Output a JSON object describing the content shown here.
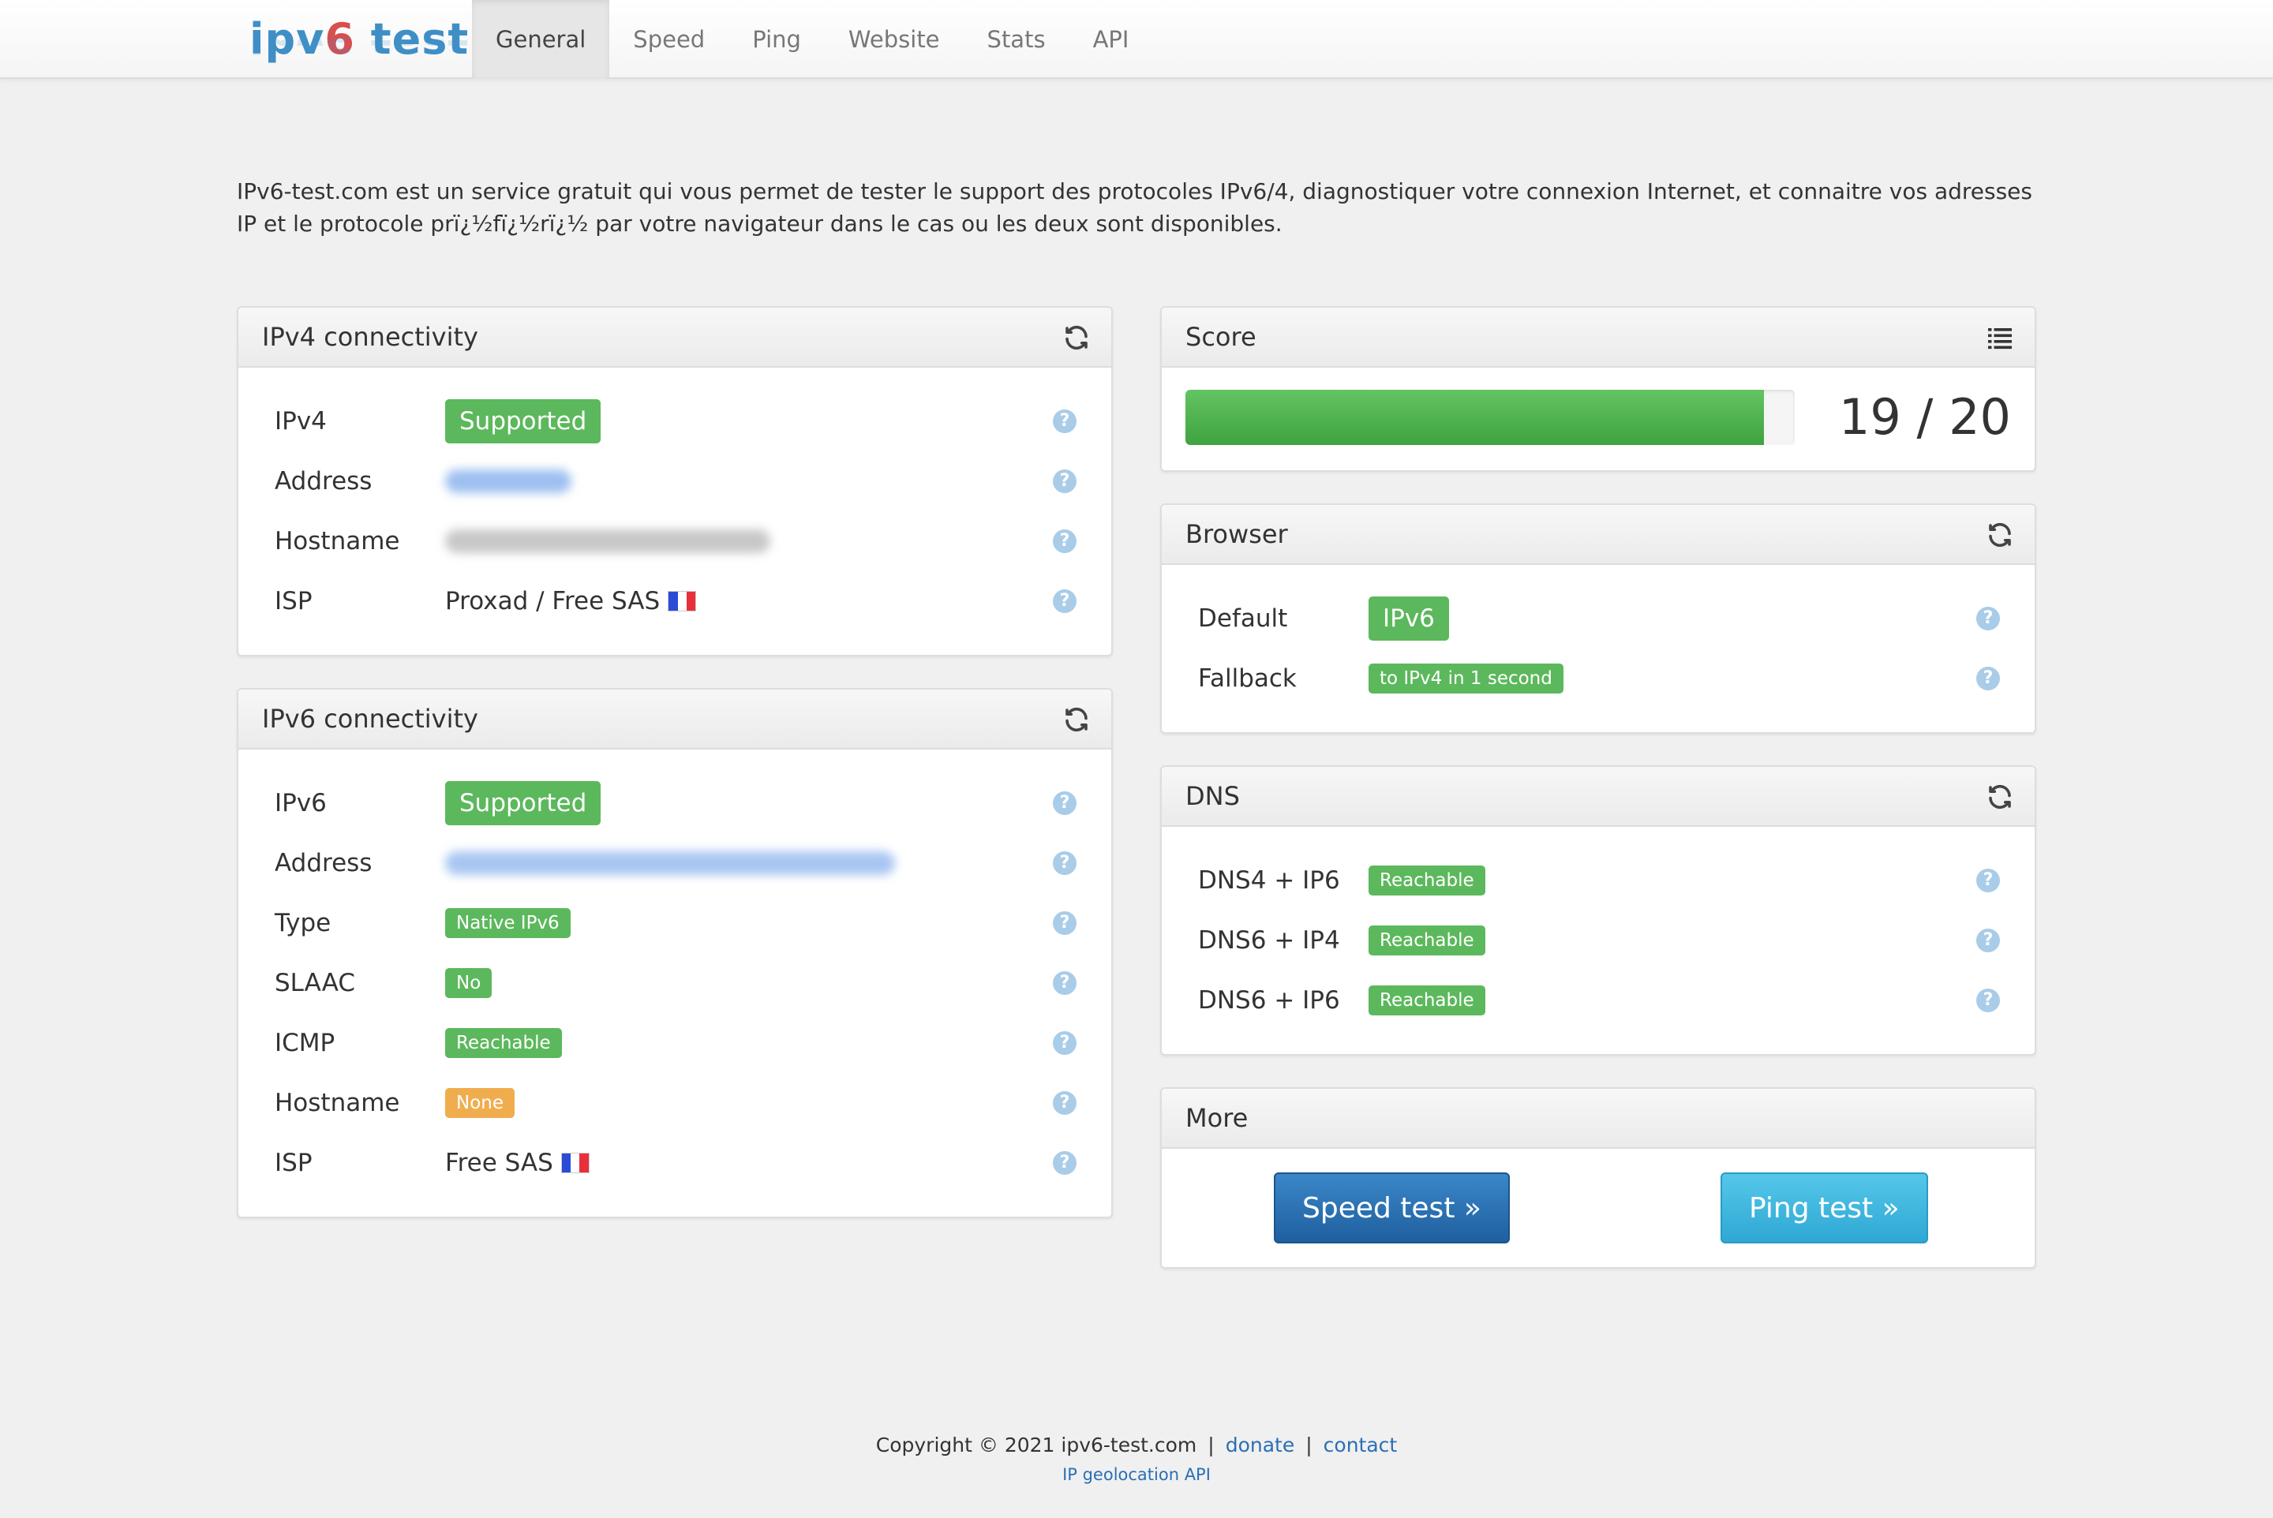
{
  "brand": {
    "part1": "ipv",
    "part2": "6",
    "part3": " test"
  },
  "nav": {
    "items": [
      {
        "label": "General"
      },
      {
        "label": "Speed"
      },
      {
        "label": "Ping"
      },
      {
        "label": "Website"
      },
      {
        "label": "Stats"
      },
      {
        "label": "API"
      }
    ],
    "active": "General"
  },
  "intro": "IPv6-test.com est un service gratuit qui vous permet de tester le support des protocoles IPv6/4, diagnostiquer votre connexion Internet, et connaitre vos adresses IP et le protocole prï¿½fï¿½rï¿½ par votre navigateur dans le cas ou les deux sont disponibles.",
  "ipv4": {
    "title": "IPv4 connectivity",
    "rows": {
      "ipv4": {
        "label": "IPv4",
        "value": "Supported"
      },
      "address": {
        "label": "Address"
      },
      "hostname": {
        "label": "Hostname"
      },
      "isp": {
        "label": "ISP",
        "value": "Proxad / Free SAS"
      }
    }
  },
  "ipv6": {
    "title": "IPv6 connectivity",
    "rows": {
      "ipv6": {
        "label": "IPv6",
        "value": "Supported"
      },
      "address": {
        "label": "Address"
      },
      "type": {
        "label": "Type",
        "value": "Native IPv6"
      },
      "slaac": {
        "label": "SLAAC",
        "value": "No"
      },
      "icmp": {
        "label": "ICMP",
        "value": "Reachable"
      },
      "hostname": {
        "label": "Hostname",
        "value": "None"
      },
      "isp": {
        "label": "ISP",
        "value": "Free SAS"
      }
    }
  },
  "score": {
    "title": "Score",
    "value": 19,
    "max": 20,
    "text": "19 / 20"
  },
  "browser": {
    "title": "Browser",
    "rows": {
      "default": {
        "label": "Default",
        "value": "IPv6"
      },
      "fallback": {
        "label": "Fallback",
        "value": "to IPv4 in 1 second"
      }
    }
  },
  "dns": {
    "title": "DNS",
    "rows": [
      {
        "label": "DNS4 + IP6",
        "value": "Reachable"
      },
      {
        "label": "DNS6 + IP4",
        "value": "Reachable"
      },
      {
        "label": "DNS6 + IP6",
        "value": "Reachable"
      }
    ]
  },
  "more": {
    "title": "More",
    "speed_button": "Speed test »",
    "ping_button": "Ping test »"
  },
  "footer": {
    "copyright": "Copyright © 2021 ipv6-test.com",
    "separator": "|",
    "donate": "donate",
    "contact": "contact",
    "geo_api": "IP geolocation API"
  },
  "colors": {
    "success": "#5cb85c",
    "warning": "#f0ad4e",
    "primary": "#2a6fb5",
    "info": "#2ea8d4",
    "help": "#a9cce8"
  },
  "icons": {
    "refresh": "refresh-icon",
    "list": "list-icon",
    "help": "help-icon",
    "flag": "france-flag-icon"
  }
}
